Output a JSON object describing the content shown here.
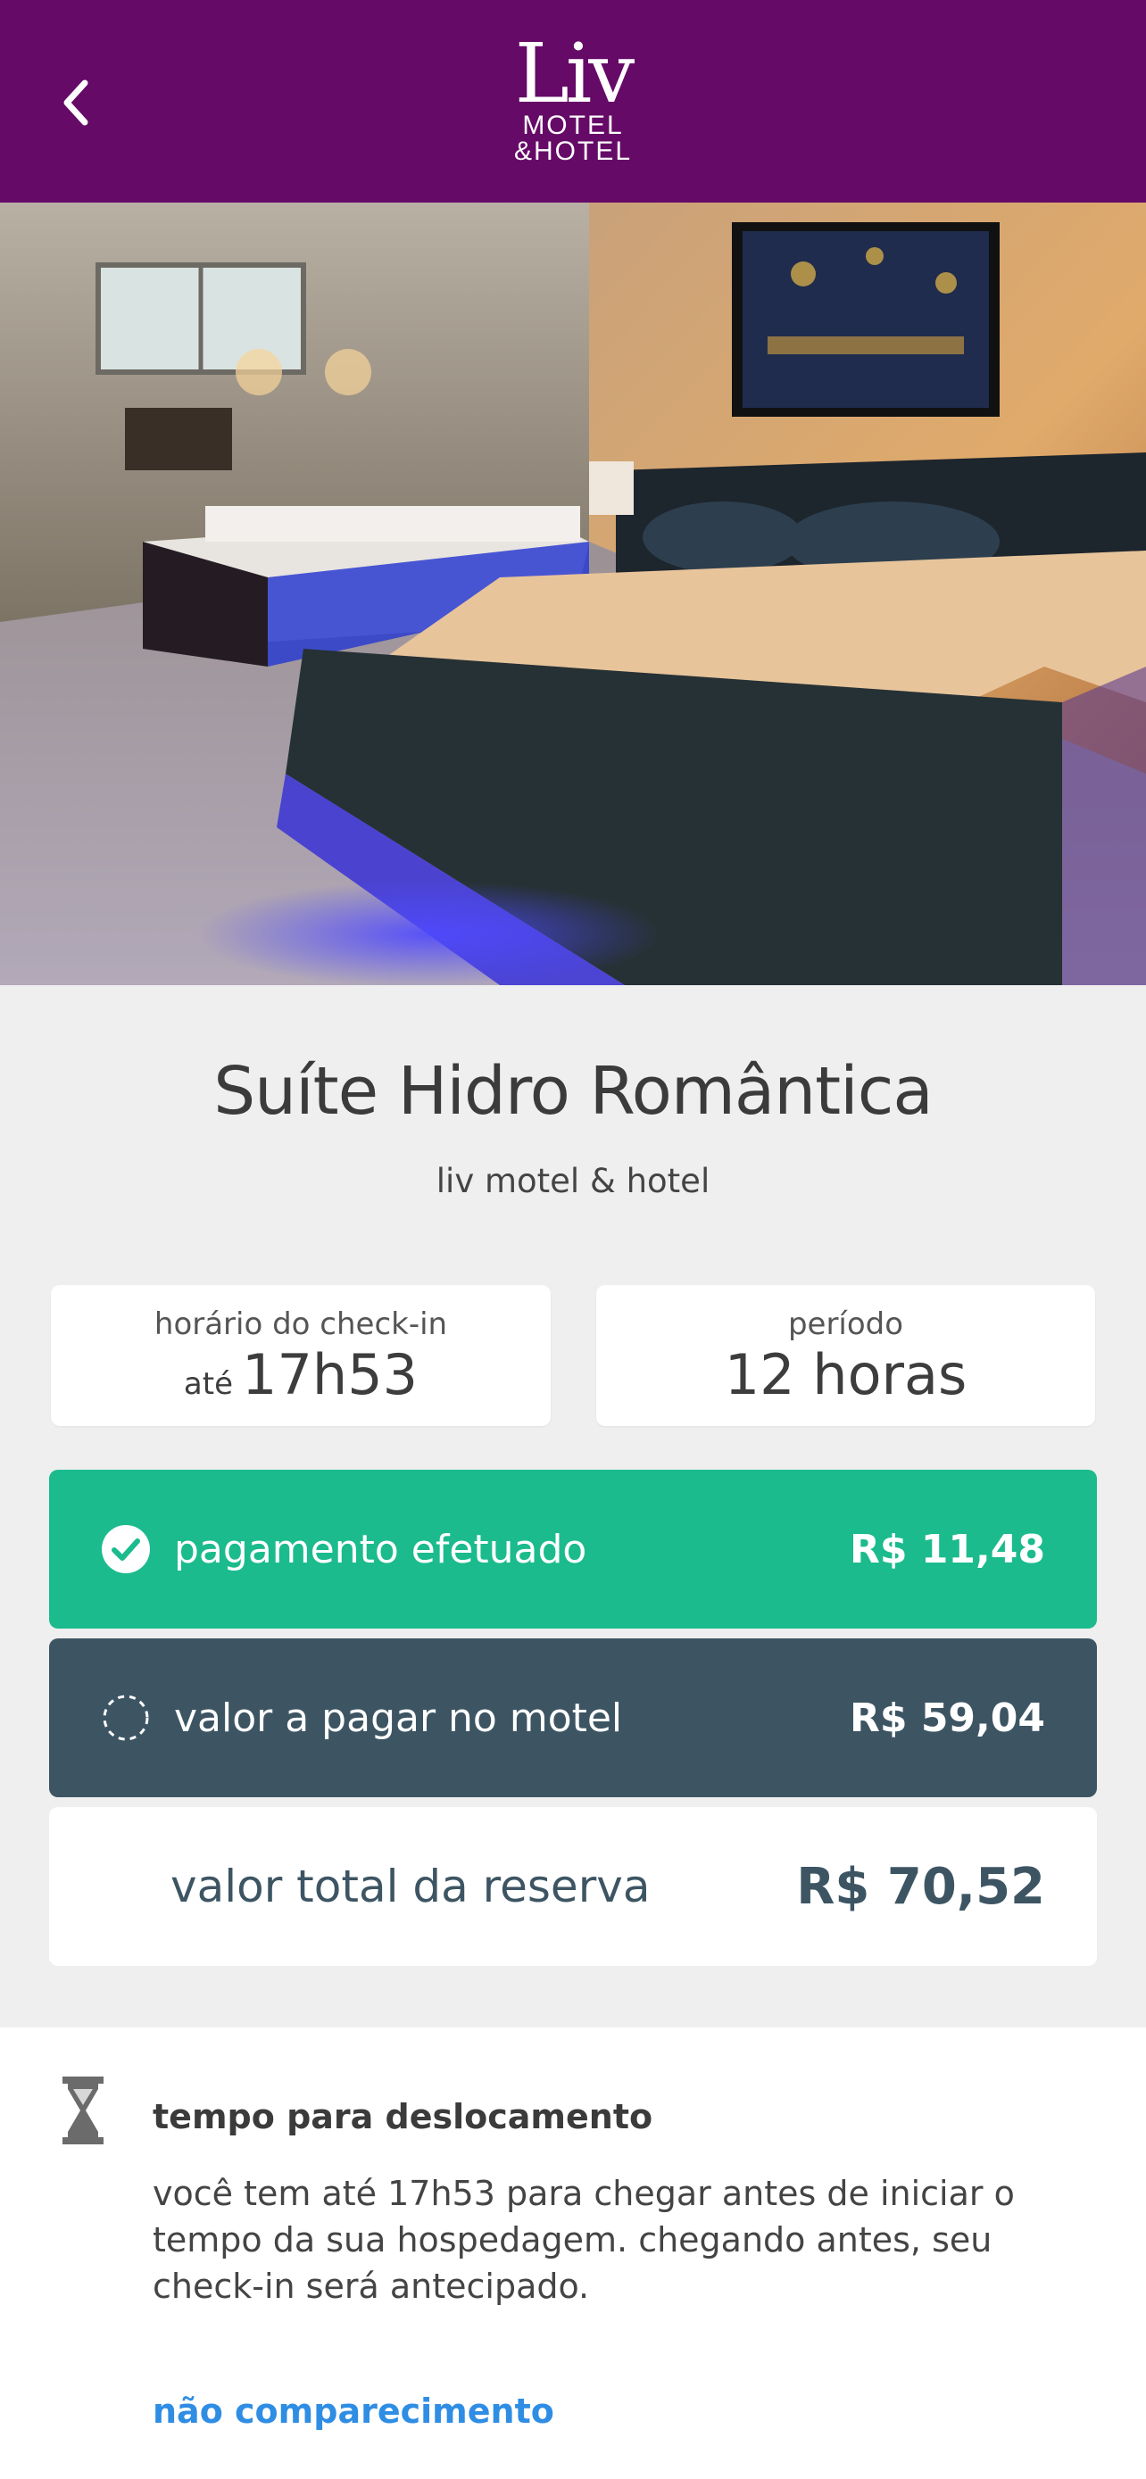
{
  "header": {
    "back_icon": "chevron-left-icon",
    "logo": {
      "mark": "Liv",
      "line1": "MOTEL",
      "line2": "&HOTEL"
    },
    "background": "#650a67"
  },
  "suite": {
    "title": "Suíte Hidro Romântica",
    "subtitle": "liv motel & hotel"
  },
  "checkin": {
    "label": "horário do check-in",
    "prefix": "até",
    "value": "17h53"
  },
  "period": {
    "label": "período",
    "value": "12 horas"
  },
  "payments": {
    "paid": {
      "icon": "check-circle-icon",
      "label": "pagamento efetuado",
      "amount": "R$ 11,48",
      "color": "#1bbb8d"
    },
    "due": {
      "icon": "dashed-circle-icon",
      "label": "valor a pagar no motel",
      "amount": "R$ 59,04",
      "color": "#3d5563"
    },
    "total": {
      "label": "valor total da reserva",
      "amount": "R$ 70,52"
    }
  },
  "travel": {
    "icon": "hourglass-icon",
    "title": "tempo para deslocamento",
    "text": "você tem até 17h53 para chegar antes de iniciar o tempo da sua hospedagem. chegando antes, seu check-in será antecipado."
  },
  "no_show": {
    "label": "não comparecimento",
    "color": "#2f8de4"
  }
}
